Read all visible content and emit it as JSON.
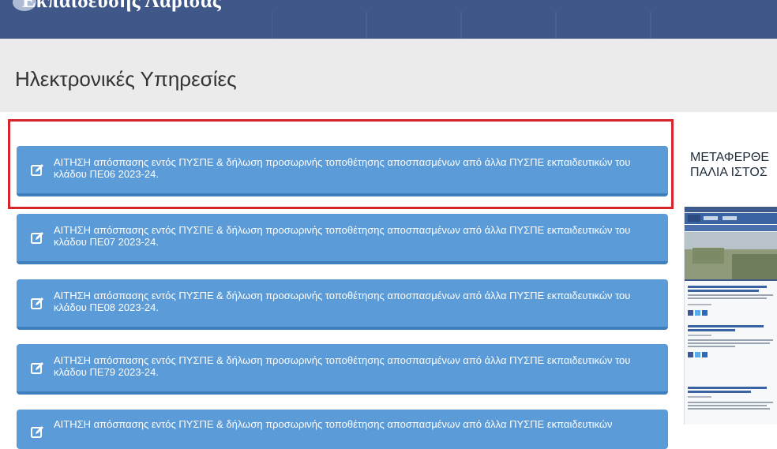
{
  "topbar": {
    "title": "Εκπαίδευσης Λάρισας",
    "bg_color": "#3f5889"
  },
  "header": {
    "title": "Ηλεκτρονικές Υπηρεσίες"
  },
  "services": [
    {
      "label": "ΑΙΤΗΣΗ απόσπασης εντός ΠΥΣΠΕ & δήλωση προσωρινής τοποθέτησης αποσπασμένων από άλλα ΠΥΣΠΕ εκπαιδευτικών του κλάδου ΠΕ06 2023-24.",
      "icon": "edit-icon",
      "highlighted": true
    },
    {
      "label": "ΑΙΤΗΣΗ απόσπασης εντός ΠΥΣΠΕ & δήλωση προσωρινής τοποθέτησης αποσπασμένων από άλλα ΠΥΣΠΕ εκπαιδευτικών του κλάδου ΠΕ07 2023-24.",
      "icon": "edit-icon"
    },
    {
      "label": "ΑΙΤΗΣΗ απόσπασης εντός ΠΥΣΠΕ & δήλωση προσωρινής τοποθέτησης αποσπασμένων από άλλα ΠΥΣΠΕ εκπαιδευτικών του κλάδου ΠΕ08 2023-24.",
      "icon": "edit-icon"
    },
    {
      "label": "ΑΙΤΗΣΗ απόσπασης εντός ΠΥΣΠΕ & δήλωση προσωρινής τοποθέτησης αποσπασμένων από άλλα ΠΥΣΠΕ εκπαιδευτικών του κλάδου ΠΕ79 2023-24.",
      "icon": "edit-icon"
    },
    {
      "label": "ΑΙΤΗΣΗ απόσπασης εντός ΠΥΣΠΕ & δήλωση προσωρινής τοποθέτησης αποσπασμένων από άλλα ΠΥΣΠΕ εκπαιδευτικών",
      "icon": "edit-icon"
    }
  ],
  "sidebar": {
    "moved_line1": "ΜΕΤΑΦΕΡΘΕ",
    "moved_line2": "ΠΑΛΙΑ ΙΣΤΟΣ"
  },
  "colors": {
    "button_bg": "#5b9bd7",
    "button_border": "#3f7fbd",
    "highlight": "#d7262b",
    "header_band": "#ebebeb"
  }
}
